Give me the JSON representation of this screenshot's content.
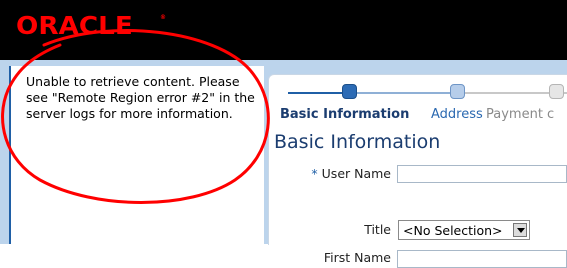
{
  "header": {
    "logo_text": "ORACLE",
    "trademark": "®"
  },
  "remote_region": {
    "error_message": "Unable to retrieve content. Please see \"Remote Region error #2\" in the server logs for more information."
  },
  "train": {
    "stops": [
      {
        "label": "Basic Information",
        "state": "current"
      },
      {
        "label": "Address",
        "state": "next"
      },
      {
        "label": "Payment c",
        "state": "disabled"
      }
    ]
  },
  "form": {
    "title": "Basic Information",
    "fields": [
      {
        "label": "User Name",
        "required": true,
        "required_marker": "*",
        "value": ""
      },
      {
        "label": "Title",
        "required": false,
        "value": "<No Selection>"
      },
      {
        "label": "First Name",
        "required": false,
        "value": ""
      }
    ]
  },
  "colors": {
    "logo": "#ff0000",
    "header_bg": "#000000",
    "accent_blue": "#1f5fa6",
    "annotation_red": "#ff0000"
  }
}
